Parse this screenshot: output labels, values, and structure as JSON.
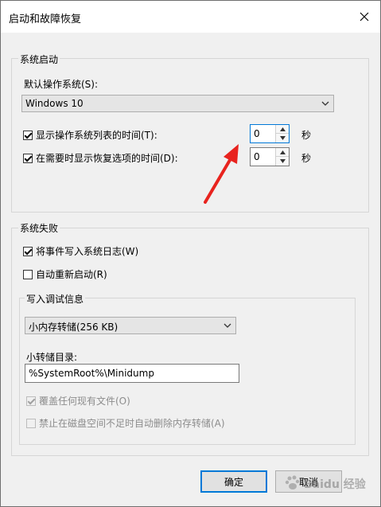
{
  "window": {
    "title": "启动和故障恢复"
  },
  "icons": {
    "close": "close-icon",
    "dropdown": "chevron-down-icon",
    "spin_up": "caret-up-icon",
    "spin_down": "caret-down-icon",
    "annotation": "red-arrow-annotation"
  },
  "system_startup": {
    "legend": "系统启动",
    "default_os_label": "默认操作系统(S):",
    "default_os_value": "Windows 10",
    "show_os_list": {
      "label": "显示操作系统列表的时间(T):",
      "checked": true,
      "value": "0",
      "unit": "秒"
    },
    "show_recovery": {
      "label": "在需要时显示恢复选项的时间(D):",
      "checked": true,
      "value": "0",
      "unit": "秒"
    }
  },
  "system_failure": {
    "legend": "系统失败",
    "write_event_log": {
      "label": "将事件写入系统日志(W)",
      "checked": true
    },
    "auto_restart": {
      "label": "自动重新启动(R)",
      "checked": false
    },
    "debug_info": {
      "legend": "写入调试信息",
      "dump_type": "小内存转储(256 KB)",
      "dump_dir_label": "小转储目录:",
      "dump_dir_value": "%SystemRoot%\\Minidump",
      "overwrite": {
        "label": "覆盖任何现有文件(O)",
        "checked": true,
        "enabled": false
      },
      "disable_auto_delete": {
        "label": "禁止在磁盘空间不足时自动删除内存转储(A)",
        "checked": false,
        "enabled": false
      }
    }
  },
  "buttons": {
    "ok": "确定",
    "cancel": "取消"
  },
  "watermark": {
    "text": "Baidu 经验"
  },
  "colors": {
    "accent": "#0078d7",
    "annotation_red": "#e8231e",
    "dialog_bg": "#f0f0f0"
  }
}
